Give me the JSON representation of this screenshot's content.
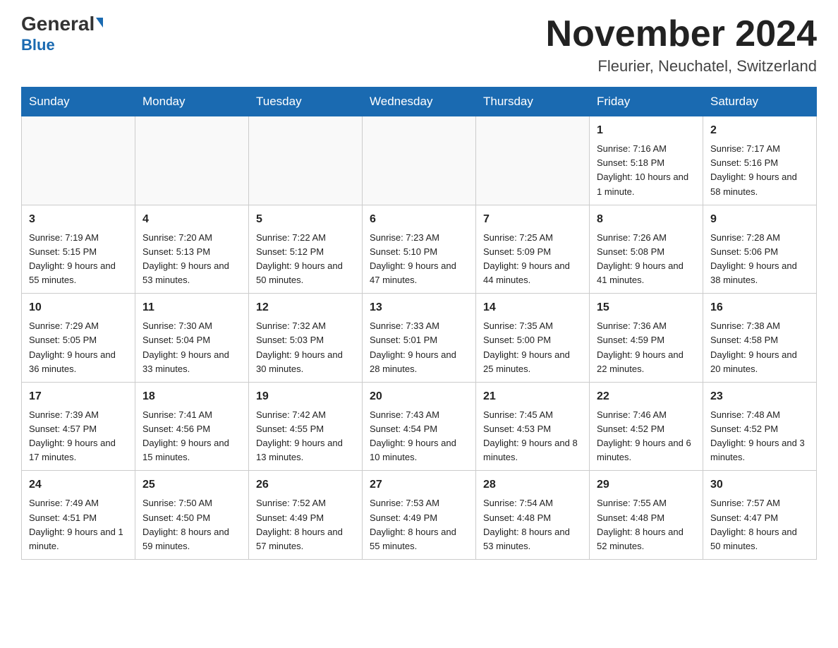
{
  "header": {
    "logo_general": "General",
    "logo_blue": "Blue",
    "month_title": "November 2024",
    "location": "Fleurier, Neuchatel, Switzerland"
  },
  "weekdays": [
    "Sunday",
    "Monday",
    "Tuesday",
    "Wednesday",
    "Thursday",
    "Friday",
    "Saturday"
  ],
  "weeks": [
    [
      {
        "day": "",
        "info": ""
      },
      {
        "day": "",
        "info": ""
      },
      {
        "day": "",
        "info": ""
      },
      {
        "day": "",
        "info": ""
      },
      {
        "day": "",
        "info": ""
      },
      {
        "day": "1",
        "info": "Sunrise: 7:16 AM\nSunset: 5:18 PM\nDaylight: 10 hours and 1 minute."
      },
      {
        "day": "2",
        "info": "Sunrise: 7:17 AM\nSunset: 5:16 PM\nDaylight: 9 hours and 58 minutes."
      }
    ],
    [
      {
        "day": "3",
        "info": "Sunrise: 7:19 AM\nSunset: 5:15 PM\nDaylight: 9 hours and 55 minutes."
      },
      {
        "day": "4",
        "info": "Sunrise: 7:20 AM\nSunset: 5:13 PM\nDaylight: 9 hours and 53 minutes."
      },
      {
        "day": "5",
        "info": "Sunrise: 7:22 AM\nSunset: 5:12 PM\nDaylight: 9 hours and 50 minutes."
      },
      {
        "day": "6",
        "info": "Sunrise: 7:23 AM\nSunset: 5:10 PM\nDaylight: 9 hours and 47 minutes."
      },
      {
        "day": "7",
        "info": "Sunrise: 7:25 AM\nSunset: 5:09 PM\nDaylight: 9 hours and 44 minutes."
      },
      {
        "day": "8",
        "info": "Sunrise: 7:26 AM\nSunset: 5:08 PM\nDaylight: 9 hours and 41 minutes."
      },
      {
        "day": "9",
        "info": "Sunrise: 7:28 AM\nSunset: 5:06 PM\nDaylight: 9 hours and 38 minutes."
      }
    ],
    [
      {
        "day": "10",
        "info": "Sunrise: 7:29 AM\nSunset: 5:05 PM\nDaylight: 9 hours and 36 minutes."
      },
      {
        "day": "11",
        "info": "Sunrise: 7:30 AM\nSunset: 5:04 PM\nDaylight: 9 hours and 33 minutes."
      },
      {
        "day": "12",
        "info": "Sunrise: 7:32 AM\nSunset: 5:03 PM\nDaylight: 9 hours and 30 minutes."
      },
      {
        "day": "13",
        "info": "Sunrise: 7:33 AM\nSunset: 5:01 PM\nDaylight: 9 hours and 28 minutes."
      },
      {
        "day": "14",
        "info": "Sunrise: 7:35 AM\nSunset: 5:00 PM\nDaylight: 9 hours and 25 minutes."
      },
      {
        "day": "15",
        "info": "Sunrise: 7:36 AM\nSunset: 4:59 PM\nDaylight: 9 hours and 22 minutes."
      },
      {
        "day": "16",
        "info": "Sunrise: 7:38 AM\nSunset: 4:58 PM\nDaylight: 9 hours and 20 minutes."
      }
    ],
    [
      {
        "day": "17",
        "info": "Sunrise: 7:39 AM\nSunset: 4:57 PM\nDaylight: 9 hours and 17 minutes."
      },
      {
        "day": "18",
        "info": "Sunrise: 7:41 AM\nSunset: 4:56 PM\nDaylight: 9 hours and 15 minutes."
      },
      {
        "day": "19",
        "info": "Sunrise: 7:42 AM\nSunset: 4:55 PM\nDaylight: 9 hours and 13 minutes."
      },
      {
        "day": "20",
        "info": "Sunrise: 7:43 AM\nSunset: 4:54 PM\nDaylight: 9 hours and 10 minutes."
      },
      {
        "day": "21",
        "info": "Sunrise: 7:45 AM\nSunset: 4:53 PM\nDaylight: 9 hours and 8 minutes."
      },
      {
        "day": "22",
        "info": "Sunrise: 7:46 AM\nSunset: 4:52 PM\nDaylight: 9 hours and 6 minutes."
      },
      {
        "day": "23",
        "info": "Sunrise: 7:48 AM\nSunset: 4:52 PM\nDaylight: 9 hours and 3 minutes."
      }
    ],
    [
      {
        "day": "24",
        "info": "Sunrise: 7:49 AM\nSunset: 4:51 PM\nDaylight: 9 hours and 1 minute."
      },
      {
        "day": "25",
        "info": "Sunrise: 7:50 AM\nSunset: 4:50 PM\nDaylight: 8 hours and 59 minutes."
      },
      {
        "day": "26",
        "info": "Sunrise: 7:52 AM\nSunset: 4:49 PM\nDaylight: 8 hours and 57 minutes."
      },
      {
        "day": "27",
        "info": "Sunrise: 7:53 AM\nSunset: 4:49 PM\nDaylight: 8 hours and 55 minutes."
      },
      {
        "day": "28",
        "info": "Sunrise: 7:54 AM\nSunset: 4:48 PM\nDaylight: 8 hours and 53 minutes."
      },
      {
        "day": "29",
        "info": "Sunrise: 7:55 AM\nSunset: 4:48 PM\nDaylight: 8 hours and 52 minutes."
      },
      {
        "day": "30",
        "info": "Sunrise: 7:57 AM\nSunset: 4:47 PM\nDaylight: 8 hours and 50 minutes."
      }
    ]
  ]
}
